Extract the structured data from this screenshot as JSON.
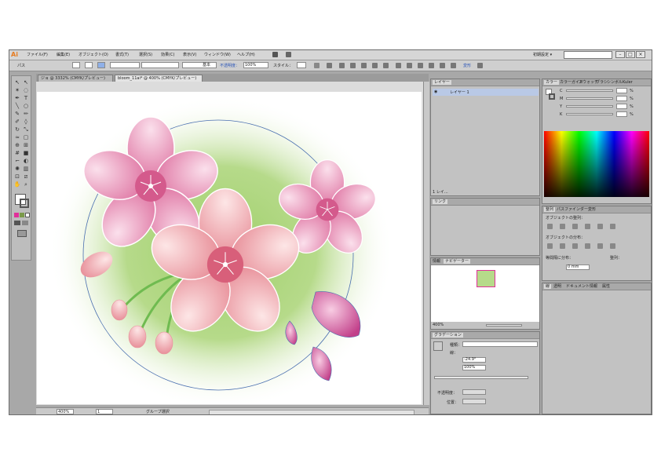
{
  "app": {
    "logo": "Ai",
    "menu": [
      "ファイル(F)",
      "編集(E)",
      "オブジェクト(O)",
      "書式(T)",
      "選択(S)",
      "効果(C)",
      "表示(V)",
      "ウィンドウ(W)",
      "ヘルプ(H)"
    ],
    "workspace": "初期設定 ▾",
    "window_buttons": [
      "–",
      "□",
      "×"
    ]
  },
  "control_bar": {
    "path_label": "パス",
    "stroke_style": "基本",
    "opacity_label": "不透明度：",
    "opacity_value": "100%",
    "style_label": "スタイル：",
    "transform_label": "変形"
  },
  "document_tabs": [
    {
      "label": "ジョ @ 3332% (CMYK/プレビュー)"
    },
    {
      "label": "bloom_11ai* @ 400% (CMYK/プレビュー)"
    }
  ],
  "status_bar": {
    "zoom": "400%",
    "page": "1",
    "status_text": "グループ選択"
  },
  "layers_panel": {
    "tab": "レイヤー",
    "layer_name": "レイヤー 1",
    "footer": "1 レイ…"
  },
  "links_panel": {
    "tab": "リンク"
  },
  "navigator_panel": {
    "tabs": [
      "情報",
      "ナビゲーター"
    ],
    "zoom": "400%"
  },
  "gradient_panel": {
    "tab": "グラデーション",
    "type_label": "種類：",
    "stroke_label": "線：",
    "angle": "-24.9°",
    "aspect": "100%",
    "opacity_label": "不透明度：",
    "location_label": "位置："
  },
  "color_panel": {
    "tabs": [
      "カラー",
      "カラーガイド",
      "スウォッチ",
      "ブラシ",
      "シンボル",
      "Kuler"
    ],
    "channels": [
      {
        "name": "C",
        "unit": "%"
      },
      {
        "name": "M",
        "unit": "%"
      },
      {
        "name": "Y",
        "unit": "%"
      },
      {
        "name": "K",
        "unit": "%"
      }
    ]
  },
  "align_panel": {
    "tabs": [
      "整列",
      "パスファインダー",
      "変形"
    ],
    "align_objects_label": "オブジェクトの整列：",
    "distribute_objects_label": "オブジェクトの分布：",
    "distribute_spacing_label": "等間隔に分布：",
    "align_to_label": "整列：",
    "spacing_value": "0 mm"
  },
  "bottom_panel": {
    "tabs": [
      "線",
      "透明",
      "ドキュメント情報",
      "属性"
    ]
  },
  "colors": {
    "petal_pink": "#f0a8c8",
    "petal_deep": "#d45a8c",
    "bud_magenta": "#c2408a",
    "stem_green": "#6fbb50",
    "bg_green": "#a8d27a",
    "selection_blue": "#4a6fb0",
    "layer_highlight": "#b9c9e6",
    "logo_orange": "#e67d21"
  }
}
